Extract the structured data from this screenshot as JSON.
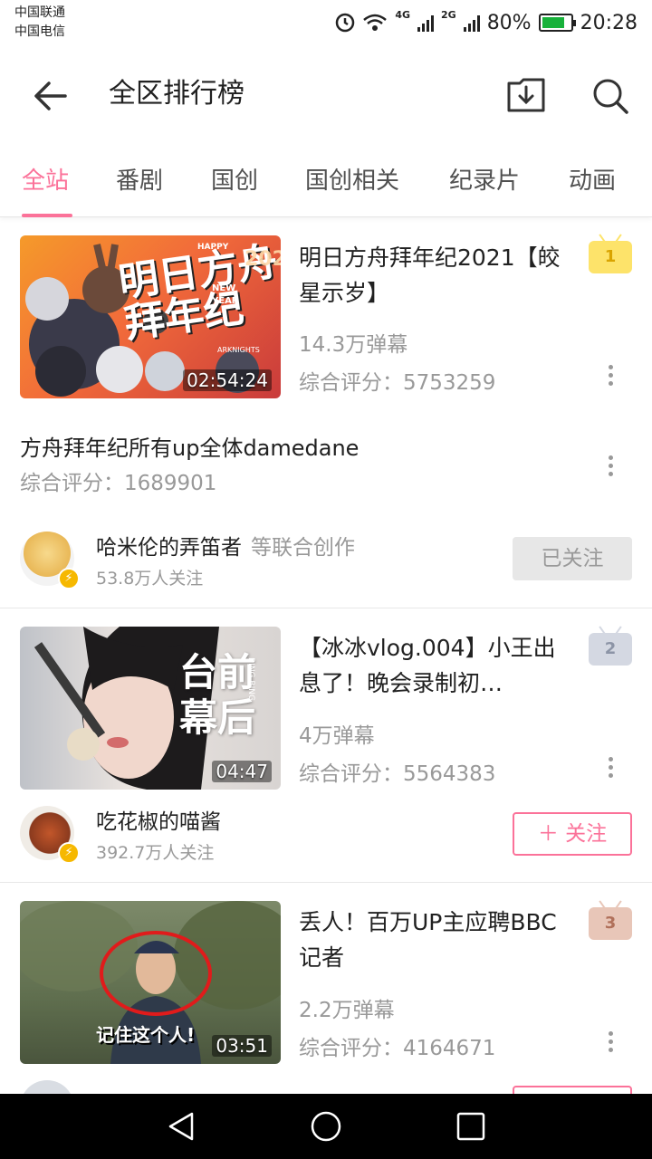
{
  "status_bar": {
    "carrier1": "中国联通",
    "carrier2": "中国电信",
    "network1": "4G",
    "network2": "2G",
    "battery": "80%",
    "battery_level": 0.8,
    "time": "20:28"
  },
  "header": {
    "title": "全区排行榜",
    "back_icon": "arrow-left-icon",
    "download_icon": "download-box-icon",
    "search_icon": "search-icon"
  },
  "tabs": [
    {
      "label": "全站",
      "active": true
    },
    {
      "label": "番剧",
      "active": false
    },
    {
      "label": "国创",
      "active": false
    },
    {
      "label": "国创相关",
      "active": false
    },
    {
      "label": "纪录片",
      "active": false
    },
    {
      "label": "动画",
      "active": false
    }
  ],
  "accent_color": "#fb7299",
  "ranking": [
    {
      "rank": "1",
      "title": "明日方舟拜年纪2021【皎星示岁】",
      "danmaku": "14.3万弹幕",
      "score": "综合评分：5753259",
      "duration": "02:54:24",
      "thumb_text": "明日方舟\n拜年纪",
      "thumb_tags": [
        "HAPPY",
        "NEW",
        "YEAR",
        "2021",
        "ARKNIGHTS"
      ],
      "sub_item": {
        "title": "方舟拜年纪所有up全体damedane",
        "score": "综合评分：1689901"
      },
      "uploader": {
        "name": "哈米伦的弄笛者",
        "co_label": "等联合创作",
        "fans": "53.8万人关注",
        "follow_label": "已关注",
        "followed": true
      }
    },
    {
      "rank": "2",
      "title": "【冰冰vlog.004】小王出息了！晚会录制初…",
      "danmaku": "4万弹幕",
      "score": "综合评分：5564383",
      "duration": "04:47",
      "thumb_text": "台前\n幕后",
      "thumb_tag": "BING BING",
      "uploader": {
        "name": "吃花椒的喵酱",
        "fans": "392.7万人关注",
        "follow_label": "＋ 关注",
        "followed": false
      }
    },
    {
      "rank": "3",
      "title": "丢人！百万UP主应聘BBC记者",
      "danmaku": "2.2万弹幕",
      "score": "综合评分：4164671",
      "duration": "03:51",
      "thumb_text": "记住这个人!"
    }
  ],
  "rank_colors": {
    "1": "#fde36a",
    "2": "#d4d8e2",
    "3": "#e8c6b8"
  },
  "nav": {
    "back_icon": "triangle-back-icon",
    "home_icon": "circle-home-icon",
    "recents_icon": "square-recents-icon"
  }
}
